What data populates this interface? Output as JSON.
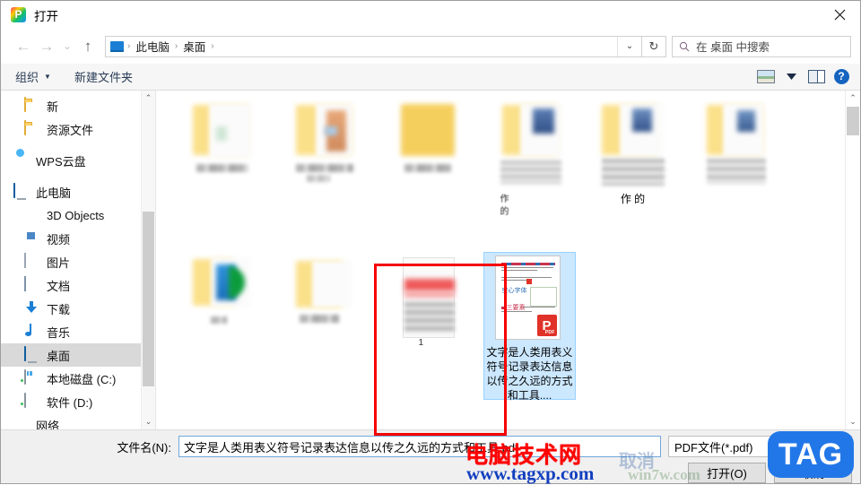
{
  "window": {
    "title": "打开",
    "app_icon": "wps-presentation-icon",
    "close_label": "✕"
  },
  "nav": {
    "back": "←",
    "forward": "→",
    "recent": "⌄",
    "up": "↑",
    "refresh": "↻",
    "breadcrumb": [
      "此电脑",
      "桌面"
    ],
    "breadcrumb_sep": "›",
    "address_dropdown": "⌄",
    "search_placeholder": "在 桌面 中搜索",
    "search_icon": "search-icon"
  },
  "command_bar": {
    "organize": "组织",
    "organize_caret": "▼",
    "new_folder": "新建文件夹",
    "view_icon": "view-picture-icon",
    "view_caret": "▼",
    "preview_pane_icon": "preview-pane-icon",
    "help_icon": "?"
  },
  "sidebar": {
    "items": [
      {
        "label": "新",
        "icon": "folder-icon",
        "indent": 1,
        "selected": false
      },
      {
        "label": "资源文件",
        "icon": "folder-icon",
        "indent": 1,
        "selected": false
      },
      {
        "label": "WPS云盘",
        "icon": "cloud-icon",
        "indent": 0,
        "selected": false
      },
      {
        "label": "此电脑",
        "icon": "computer-icon",
        "indent": 0,
        "selected": false
      },
      {
        "label": "3D Objects",
        "icon": "3d-objects-icon",
        "indent": 2,
        "selected": false
      },
      {
        "label": "视频",
        "icon": "video-icon",
        "indent": 2,
        "selected": false
      },
      {
        "label": "图片",
        "icon": "pictures-icon",
        "indent": 2,
        "selected": false
      },
      {
        "label": "文档",
        "icon": "documents-icon",
        "indent": 2,
        "selected": false
      },
      {
        "label": "下载",
        "icon": "downloads-icon",
        "indent": 2,
        "selected": false
      },
      {
        "label": "音乐",
        "icon": "music-icon",
        "indent": 2,
        "selected": false
      },
      {
        "label": "桌面",
        "icon": "desktop-icon",
        "indent": 2,
        "selected": true
      },
      {
        "label": "本地磁盘 (C:)",
        "icon": "local-disk-icon",
        "indent": 2,
        "selected": false
      },
      {
        "label": "软件 (D:)",
        "icon": "disk-icon",
        "indent": 2,
        "selected": false
      },
      {
        "label": "网络",
        "icon": "network-icon",
        "indent": 0,
        "selected": false
      }
    ],
    "scroll_up": "⌃",
    "scroll_down": "⌄"
  },
  "files": {
    "items": [
      {
        "name": "",
        "kind": "folder-blurred",
        "selected": false
      },
      {
        "name": "",
        "kind": "folder-blurred",
        "selected": false
      },
      {
        "name": "",
        "kind": "folder-blurred",
        "selected": false
      },
      {
        "name": "",
        "kind": "folder-blurred",
        "selected": false
      },
      {
        "name": "作\n的",
        "kind": "folder-blurred",
        "selected": false
      },
      {
        "name": "",
        "kind": "folder-blurred",
        "selected": false
      },
      {
        "name": "",
        "kind": "folder-green-blurred",
        "selected": false
      },
      {
        "name": "",
        "kind": "folder-blurred",
        "selected": false
      },
      {
        "name": "1",
        "kind": "doc-blurred",
        "selected": false
      },
      {
        "name": "文字是人类用表义符号记录表达信息以传之久远的方式和工具....",
        "kind": "pdf",
        "selected": true
      }
    ],
    "pdf_badge_letter": "P",
    "pdf_badge_text": "PDF",
    "scroll_up": "⌃",
    "scroll_down": "⌄"
  },
  "footer": {
    "filename_label": "文件名(N):",
    "filename_value": "文字是人类用表义符号记录表达信息以传之久远的方式和工具.pdf",
    "filename_caret": "⌄",
    "filetype_value": "PDF文件(*.pdf)",
    "filetype_caret": "⌄",
    "open_button": "打开(O)",
    "cancel_button": "取消"
  },
  "watermarks": {
    "red_text": "电脑技术网",
    "url_text": "www.tagxp.com",
    "tag_text": "TAG",
    "faint_text": "取消",
    "faint_text2": "win7w.com"
  },
  "colors": {
    "selection_blue": "#cce8ff",
    "selection_border": "#99d1ff",
    "annotation_red": "#f60000",
    "accent_blue": "#1a7fd4",
    "watermark_red": "#ff0000",
    "watermark_blue": "#2277e8"
  }
}
